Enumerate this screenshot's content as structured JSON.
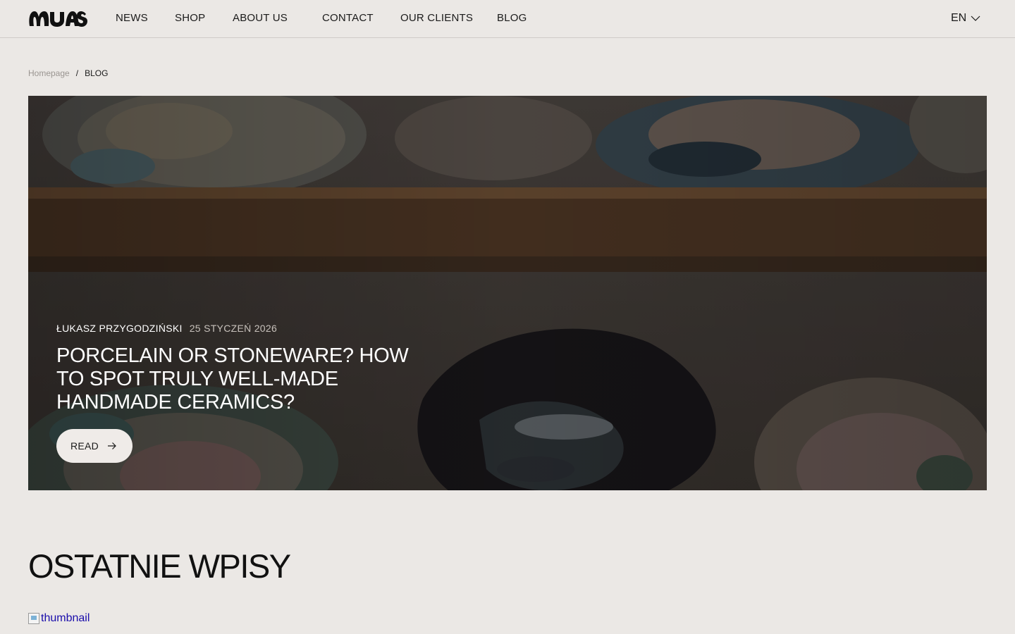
{
  "header": {
    "logo_name": "MUAS logo",
    "nav": [
      {
        "label": "NEWS"
      },
      {
        "label": "SHOP"
      },
      {
        "label": "ABOUT US"
      },
      {
        "label": "CONTACT"
      },
      {
        "label": "OUR CLIENTS"
      },
      {
        "label": "BLOG"
      }
    ],
    "language": "EN"
  },
  "breadcrumb": {
    "home": "Homepage",
    "separator": "/",
    "current": "BLOG"
  },
  "hero": {
    "author": "ŁUKASZ PRZYGODZIŃSKI",
    "date": "25 STYCZEŃ 2026",
    "title": "PORCELAIN OR STONEWARE? HOW TO SPOT TRULY WELL-MADE HANDMADE CERAMICS?",
    "read_label": "READ"
  },
  "recent": {
    "title": "OSTATNIE WPISY",
    "thumbnail_alt": "thumbnail"
  },
  "colors": {
    "background": "#ebe8e5",
    "button_bg": "#efebe8",
    "text": "#1a1a1a",
    "muted": "#9a9591",
    "link": "#1a0dab"
  }
}
